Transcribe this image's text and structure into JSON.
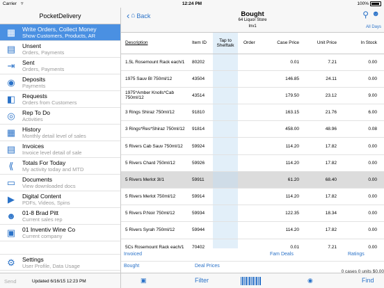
{
  "status": {
    "carrier": "Carrier",
    "time": "12:24 PM",
    "battery": "100%"
  },
  "sidebar": {
    "title": "PocketDelivery",
    "items": [
      {
        "label": "Write Orders, Collect Money",
        "sub": "Show Customers, Products, AR",
        "icon": "write-orders-icon",
        "active": true
      },
      {
        "label": "Unsent",
        "sub": "Orders, Payments",
        "icon": "unsent-icon"
      },
      {
        "label": "Sent",
        "sub": "Orders, Payments",
        "icon": "sent-icon"
      },
      {
        "label": "Deposits",
        "sub": "Payments",
        "icon": "deposits-icon"
      },
      {
        "label": "Requests",
        "sub": "Orders from Customers",
        "icon": "requests-icon"
      },
      {
        "label": "Rep To Do",
        "sub": "Activities",
        "icon": "target-icon"
      },
      {
        "label": "History",
        "sub": "Monthly detail level of sales",
        "icon": "history-icon"
      },
      {
        "label": "Invoices",
        "sub": "Invoice level detail of sale",
        "icon": "invoices-icon"
      },
      {
        "label": "Totals For Today",
        "sub": "My activity today and MTD",
        "icon": "tally-icon"
      },
      {
        "label": "Documents",
        "sub": "View downloaded docs",
        "icon": "documents-icon"
      },
      {
        "label": "Digital Content",
        "sub": "PDFs, Videos, Spins",
        "icon": "digital-content-icon"
      },
      {
        "label": "01-8 Brad Pitt",
        "sub": "Current sales rep",
        "icon": "sales-rep-icon"
      },
      {
        "label": "01 Inventiv Wine Co",
        "sub": "Current company",
        "icon": "company-icon"
      }
    ],
    "settings": {
      "label": "Settings",
      "sub": "User Profile, Data Usage"
    },
    "footer": {
      "send": "Send",
      "updated": "Updated 6/16/15     12:23 PM"
    }
  },
  "nav": {
    "back_label": "Back",
    "title": "Bought",
    "subtitle": "64 Liquor Store",
    "subtitle2": "Inv1",
    "all_days": "All Days"
  },
  "table": {
    "headers": {
      "desc": "Description",
      "id": "Item ID",
      "tap": "Tap to Shelftalk",
      "order": "Order",
      "case": "Case Price",
      "unit": "Unit Price",
      "stock": "In Stock"
    },
    "rows": [
      {
        "desc": "1.5L Rosemount Rack each/1",
        "id": "80202",
        "order": "",
        "case": "0.01",
        "unit": "7.21",
        "stock": "0.00"
      },
      {
        "desc": "1975 Sauv Bl 750ml/12",
        "id": "43504",
        "order": "",
        "case": "146.85",
        "unit": "24.11",
        "stock": "0.00"
      },
      {
        "desc": "1975*Amber Knolls*Cab 750ml/12",
        "id": "43514",
        "order": "",
        "case": "179.50",
        "unit": "23.12",
        "stock": "9.00"
      },
      {
        "desc": "3 Rings Shiraz 750ml/12",
        "id": "91810",
        "order": "",
        "case": "163.15",
        "unit": "21.76",
        "stock": "6.00"
      },
      {
        "desc": "3 Rings*Res*Shiraz 750ml/12",
        "id": "91814",
        "order": "",
        "case": "458.00",
        "unit": "48.96",
        "stock": "0.08"
      },
      {
        "desc": "5 Rivers Cab Sauv 750ml/12",
        "id": "59924",
        "order": "",
        "case": "114.20",
        "unit": "17.82",
        "stock": "0.00"
      },
      {
        "desc": "5 Rivers Chard 750ml/12",
        "id": "59926",
        "order": "",
        "case": "114.20",
        "unit": "17.82",
        "stock": "0.00"
      },
      {
        "desc": "5 Rivers Merlot 3l/1",
        "id": "59911",
        "order": "",
        "case": "61.20",
        "unit": "68.40",
        "stock": "0.00",
        "highlight": true
      },
      {
        "desc": "5 Rivers Merlot 750ml/12",
        "id": "59914",
        "order": "",
        "case": "114.20",
        "unit": "17.82",
        "stock": "0.00"
      },
      {
        "desc": "5 Rivers P.Noir 750ml/12",
        "id": "59934",
        "order": "",
        "case": "122.35",
        "unit": "18.34",
        "stock": "0.00"
      },
      {
        "desc": "5 Rivers Syrah 750ml/12",
        "id": "59944",
        "order": "",
        "case": "114.20",
        "unit": "17.82",
        "stock": "0.00"
      },
      {
        "desc": "5Cs Rosemount Rack each/1",
        "id": "70402",
        "order": "",
        "case": "0.01",
        "unit": "7.21",
        "stock": "0.00"
      }
    ]
  },
  "links": {
    "invoiced": "Invoiced",
    "fam_deals": "Fam Deals",
    "ratings": "Ratings",
    "bought": "Bought",
    "deal_prices": "Deal Prices",
    "summary": "0 cases 0 units $0.00"
  },
  "toolbar": {
    "filter": "Filter",
    "find": "Find"
  },
  "colors": {
    "accent": "#2a72c8",
    "active_row": "#4a90e2",
    "tap_column": "#e2eff9"
  }
}
